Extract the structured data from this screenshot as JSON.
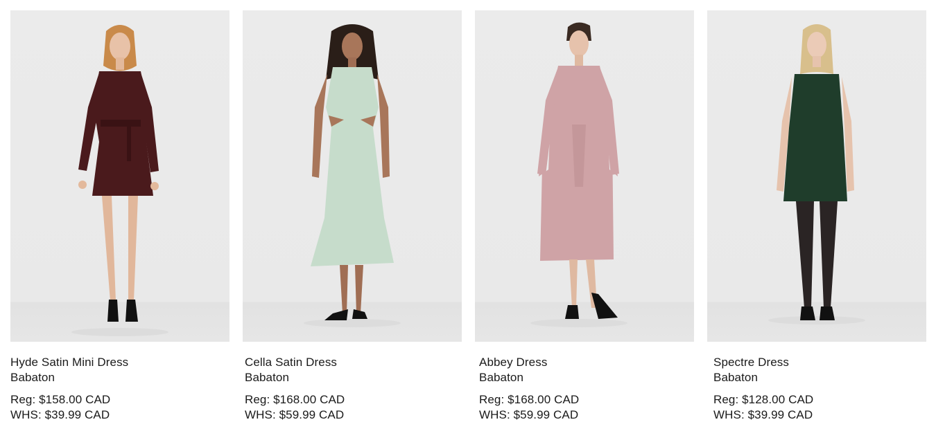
{
  "products": [
    {
      "name": "Hyde Satin Mini Dress",
      "brand": "Babaton",
      "reg_price": "Reg: $158.00 CAD",
      "whs_price": "WHS: $39.99 CAD",
      "image_icon": "model-photo-icon",
      "dress_color": "#4a1a1c"
    },
    {
      "name": "Cella Satin Dress",
      "brand": "Babaton",
      "reg_price": "Reg: $168.00 CAD",
      "whs_price": "WHS: $59.99 CAD",
      "image_icon": "model-photo-icon",
      "dress_color": "#c6dccb"
    },
    {
      "name": "Abbey Dress",
      "brand": "Babaton",
      "reg_price": "Reg: $168.00 CAD",
      "whs_price": "WHS: $59.99 CAD",
      "image_icon": "model-photo-icon",
      "dress_color": "#cfa3a6"
    },
    {
      "name": "Spectre Dress",
      "brand": "Babaton",
      "reg_price": "Reg: $128.00 CAD",
      "whs_price": "WHS: $39.99 CAD",
      "image_icon": "model-photo-icon",
      "dress_color": "#1f3d2b"
    }
  ]
}
